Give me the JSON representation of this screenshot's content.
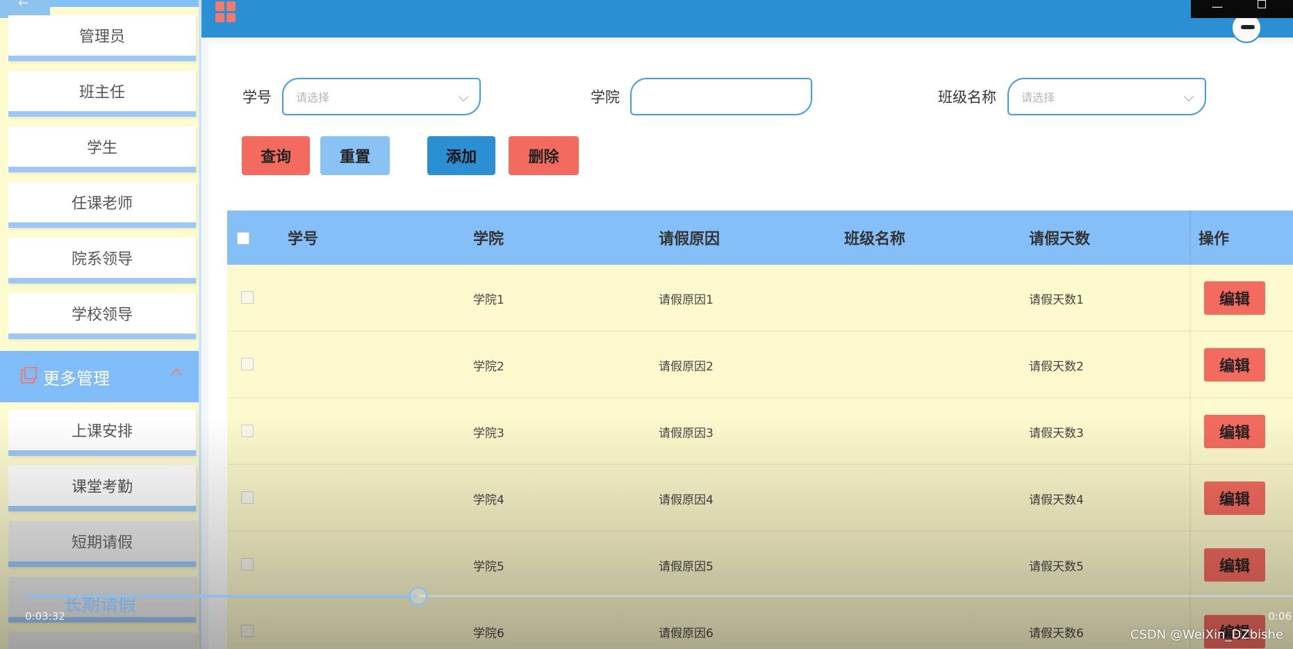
{
  "header": {
    "accent": "#2a8fd3"
  },
  "sidebar": {
    "back_icon": "arrow-left-icon",
    "items_top": [
      {
        "label": "管理员"
      },
      {
        "label": "班主任"
      },
      {
        "label": "学生"
      },
      {
        "label": "任课老师"
      },
      {
        "label": "院系领导"
      },
      {
        "label": "学校领导"
      }
    ],
    "group": {
      "label": "更多管理",
      "icon": "copy-icon",
      "expanded": true
    },
    "items_bottom": [
      {
        "label": "上课安排"
      },
      {
        "label": "课堂考勤"
      },
      {
        "label": "短期请假"
      }
    ]
  },
  "filters": {
    "student_id_label": "学号",
    "student_id_placeholder": "请选择",
    "college_label": "学院",
    "college_value": "",
    "class_name_label": "班级名称",
    "class_name_placeholder": "请选择"
  },
  "actions": {
    "query": "查询",
    "reset": "重置",
    "add": "添加",
    "delete": "删除"
  },
  "table": {
    "columns": [
      "学号",
      "学院",
      "请假原因",
      "班级名称",
      "请假天数",
      "操作"
    ],
    "rows": [
      {
        "student_id": "",
        "college": "学院1",
        "reason": "请假原因1",
        "class_name": "",
        "days": "请假天数1",
        "action": "编辑"
      },
      {
        "student_id": "",
        "college": "学院2",
        "reason": "请假原因2",
        "class_name": "",
        "days": "请假天数2",
        "action": "编辑"
      },
      {
        "student_id": "",
        "college": "学院3",
        "reason": "请假原因3",
        "class_name": "",
        "days": "请假天数3",
        "action": "编辑"
      },
      {
        "student_id": "",
        "college": "学院4",
        "reason": "请假原因4",
        "class_name": "",
        "days": "请假天数4",
        "action": "编辑"
      },
      {
        "student_id": "",
        "college": "学院5",
        "reason": "请假原因5",
        "class_name": "",
        "days": "请假天数5",
        "action": "编辑"
      },
      {
        "student_id": "",
        "college": "学院6",
        "reason": "请假原因6",
        "class_name": "",
        "days": "请假天数6",
        "action": "编辑"
      }
    ]
  },
  "video_overlay": {
    "title": "长期请假",
    "elapsed": "0:03:32",
    "total": "0:06",
    "progress": 0.31
  },
  "watermark": "CSDN @WeiXin_DZbishe",
  "colors": {
    "red": "#f36b5e",
    "light_blue": "#89c3f6",
    "header_blue": "#2a8fd3",
    "row_yellow": "#fcf9cc"
  }
}
